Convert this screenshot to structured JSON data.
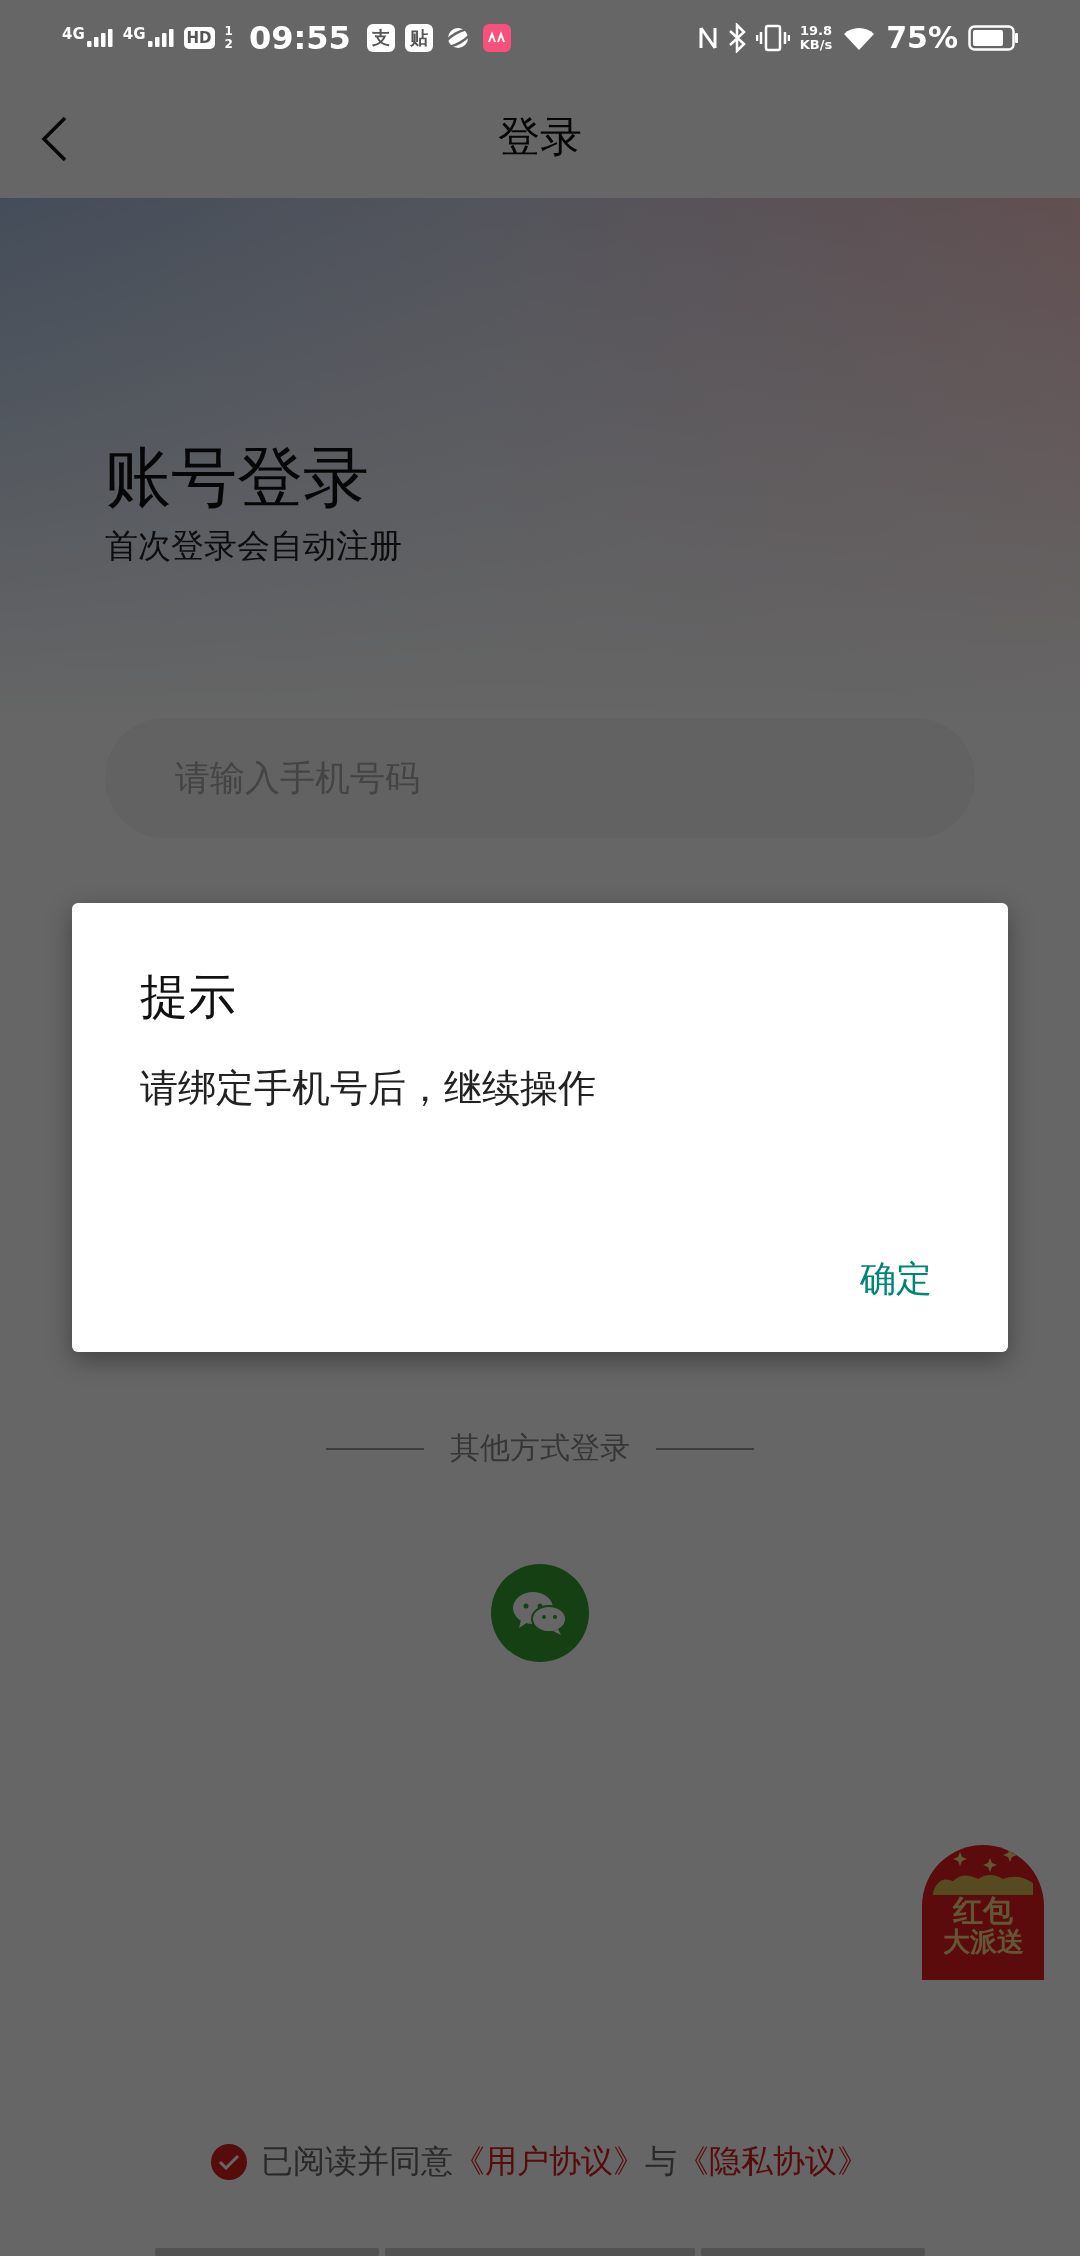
{
  "status_bar": {
    "signals": [
      {
        "label": "4G"
      },
      {
        "label": "4G"
      }
    ],
    "hd": {
      "label": "HD",
      "sup": "1",
      "sub": "2"
    },
    "time": "09:55",
    "notification_icons": [
      {
        "kind": "glyph",
        "label": "支"
      },
      {
        "kind": "glyph",
        "label": "贴"
      },
      {
        "kind": "planet"
      },
      {
        "kind": "app"
      }
    ],
    "speed": {
      "value": "19.8",
      "unit": "KB/s"
    },
    "battery": {
      "percent": "75%"
    }
  },
  "nav": {
    "title": "登录"
  },
  "login": {
    "heading": "账号登录",
    "subheading": "首次登录会自动注册",
    "phone_field": {
      "placeholder": "请输入手机号码"
    }
  },
  "other_login": {
    "label": "其他方式登录",
    "methods": [
      {
        "kind": "wechat"
      }
    ]
  },
  "promo_badge": {
    "lines": [
      "红包",
      "大派送"
    ]
  },
  "agreement": {
    "checked": true,
    "parts": [
      {
        "kind": "text",
        "text": "已阅读并同意"
      },
      {
        "kind": "link",
        "text": "《用户协议》"
      },
      {
        "kind": "text",
        "text": "与"
      },
      {
        "kind": "link",
        "text": "《隐私协议》"
      }
    ]
  },
  "dialog": {
    "title": "提示",
    "message": "请绑定手机号后，继续操作",
    "buttons": [
      {
        "label": "确定"
      }
    ]
  }
}
